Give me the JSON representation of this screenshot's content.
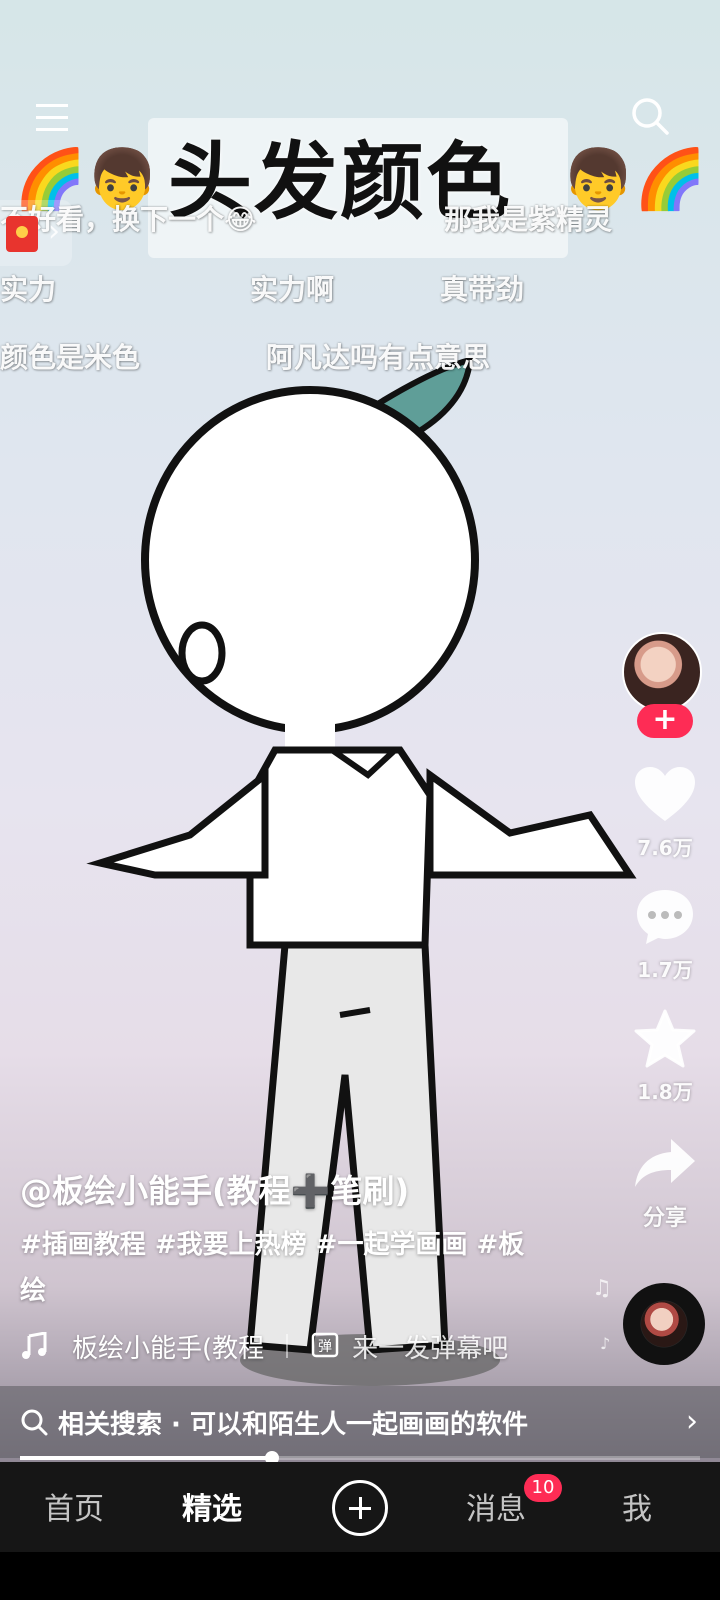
{
  "video": {
    "title_text": "头发颜色",
    "emoji_left": "🌈👦",
    "emoji_right": "👦🌈"
  },
  "danmaku": [
    "不好看，换下一个😂",
    "那我是紫精灵",
    "实力",
    "实力啊",
    "真带劲",
    "颜色是米色",
    "阿凡达吗有点意思"
  ],
  "actions": {
    "follow_label": "+",
    "like_count": "7.6万",
    "comment_count": "1.7万",
    "favorite_count": "1.8万",
    "share_label": "分享"
  },
  "caption": {
    "author": "@板绘小能手(教程➕笔刷)",
    "description": "#插画教程 #我要上热榜 #一起学画画 #板绘",
    "music": "板绘小能手(教程",
    "danmaku_prompt": "来一发弹幕吧"
  },
  "related_search": {
    "label": "相关搜索 · 可以和陌生人一起画画的软件"
  },
  "progress": {
    "fraction": 0.37
  },
  "nav": {
    "home": "首页",
    "featured": "精选",
    "messages": "消息",
    "messages_badge": "10",
    "me": "我"
  },
  "colors": {
    "accent": "#fe2c55",
    "nav_bg": "#161616"
  }
}
